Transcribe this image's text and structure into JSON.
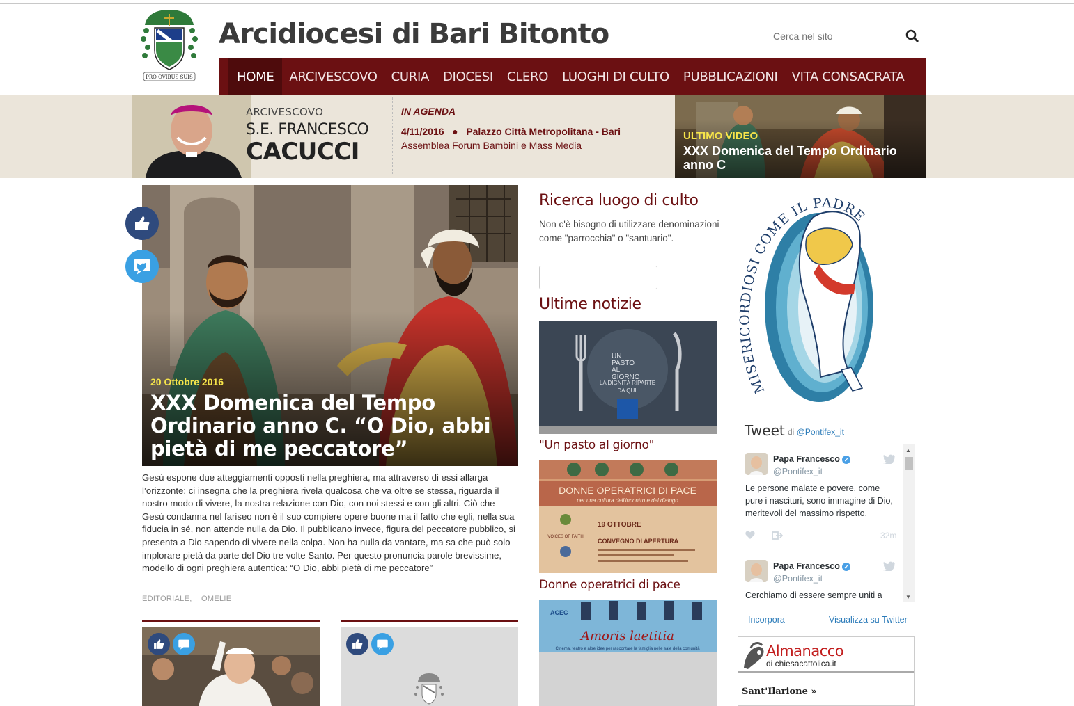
{
  "site": {
    "title": "Arcidiocesi di Bari Bitonto",
    "logo_motto": "PRO OVIBUS SUIS"
  },
  "search": {
    "placeholder": "Cerca nel sito"
  },
  "nav": {
    "items": [
      {
        "label": "HOME",
        "active": true
      },
      {
        "label": "ARCIVESCOVO"
      },
      {
        "label": "CURIA"
      },
      {
        "label": "DIOCESI"
      },
      {
        "label": "CLERO"
      },
      {
        "label": "LUOGHI DI CULTO"
      },
      {
        "label": "PUBBLICAZIONI"
      },
      {
        "label": "VITA CONSACRATA"
      }
    ]
  },
  "archbishop": {
    "role": "ARCIVESCOVO",
    "name_line1": "S.E. FRANCESCO",
    "name_line2": "CACUCCI"
  },
  "agenda": {
    "title": "IN AGENDA",
    "date": "4/11/2016",
    "place": "Palazzo Città Metropolitana - Bari",
    "event": "Assemblea Forum Bambini e Mass Media"
  },
  "video": {
    "label": "ULTIMO VIDEO",
    "title": "XXX Domenica del Tempo Ordinario anno C"
  },
  "hero": {
    "date": "20 Ottobre 2016",
    "title": "XXX Domenica del Tempo Ordinario anno C. “O Dio, abbi pietà di me peccatore”",
    "text": "Gesù espone due atteggiamenti opposti nella preghiera, ma attraverso di essi allarga l’orizzonte: ci insegna che la preghiera rivela qualcosa che va oltre se stessa, riguarda il nostro modo di vivere, la nostra relazione con Dio, con noi stessi e con gli altri. Ciò che Gesù condanna nel fariseo non è il suo compiere opere buone ma il fatto che egli, nella sua fiducia in sé, non attende nulla da Dio. Il pubblicano invece, figura del peccatore pubblico, si presenta a Dio sapendo di vivere nella colpa. Non ha nulla da vantare, ma sa che può solo implorare pietà da parte del Dio tre volte Santo. Per questo pronuncia parole brevissime, modello di ogni preghiera autentica: “O Dio, abbi pietà di me peccatore”",
    "tags": [
      "EDITORIALE,",
      "OMELIE"
    ]
  },
  "ricerca": {
    "title": "Ricerca luogo di culto",
    "hint": "Non c'è bisogno di utilizzare denominazioni come \"parrocchia\" o \"santuario\"."
  },
  "news": {
    "title": "Ultime notizie",
    "items": [
      {
        "title": "\"Un pasto al giorno\"",
        "img_text": [
          "UN",
          "PASTO",
          "AL",
          "GIORNO",
          "LA DIGNITÀ RIPARTE",
          "DA QUI."
        ]
      },
      {
        "title": "Donne operatrici di pace",
        "img_text": [
          "DONNE OPERATRICI DI PACE",
          "per una cultura dell'incontro e del dialogo",
          "19 OTTOBRE",
          "CONVEGNO DI APERTURA",
          "VOICES OF FAITH"
        ]
      },
      {
        "title": "",
        "img_text": [
          "ACEC",
          "Amoris laetitia",
          "Cinema, teatro e altre idee per raccontare la famiglia nelle sale della comunità"
        ]
      }
    ]
  },
  "jubilee": {
    "text": "MISERICORDIOSI COME IL PADRE"
  },
  "twitter": {
    "heading": "Tweet",
    "by_prefix": "di",
    "by_handle": "@Pontifex_it",
    "tweets": [
      {
        "name": "Papa Francesco",
        "handle": "@Pontifex_it",
        "text": "Le persone malate e povere, come pure i nascituri, sono immagine di Dio, meritevoli del massimo rispetto.",
        "time": "32m"
      },
      {
        "name": "Papa Francesco",
        "handle": "@Pontifex_it",
        "text": "Cerchiamo di essere sempre uniti a",
        "time": ""
      }
    ],
    "embed_label": "Incorpora",
    "view_label": "Visualizza su Twitter"
  },
  "almanacco": {
    "title": "Almanacco",
    "subtitle": "di chiesacattolica.it",
    "saint": "Sant'Ilarione »"
  },
  "colors": {
    "brand": "#6b1012",
    "accent_yellow": "#f7e54a",
    "facebook": "#2f4a7d",
    "twitter": "#3aa0e3"
  }
}
